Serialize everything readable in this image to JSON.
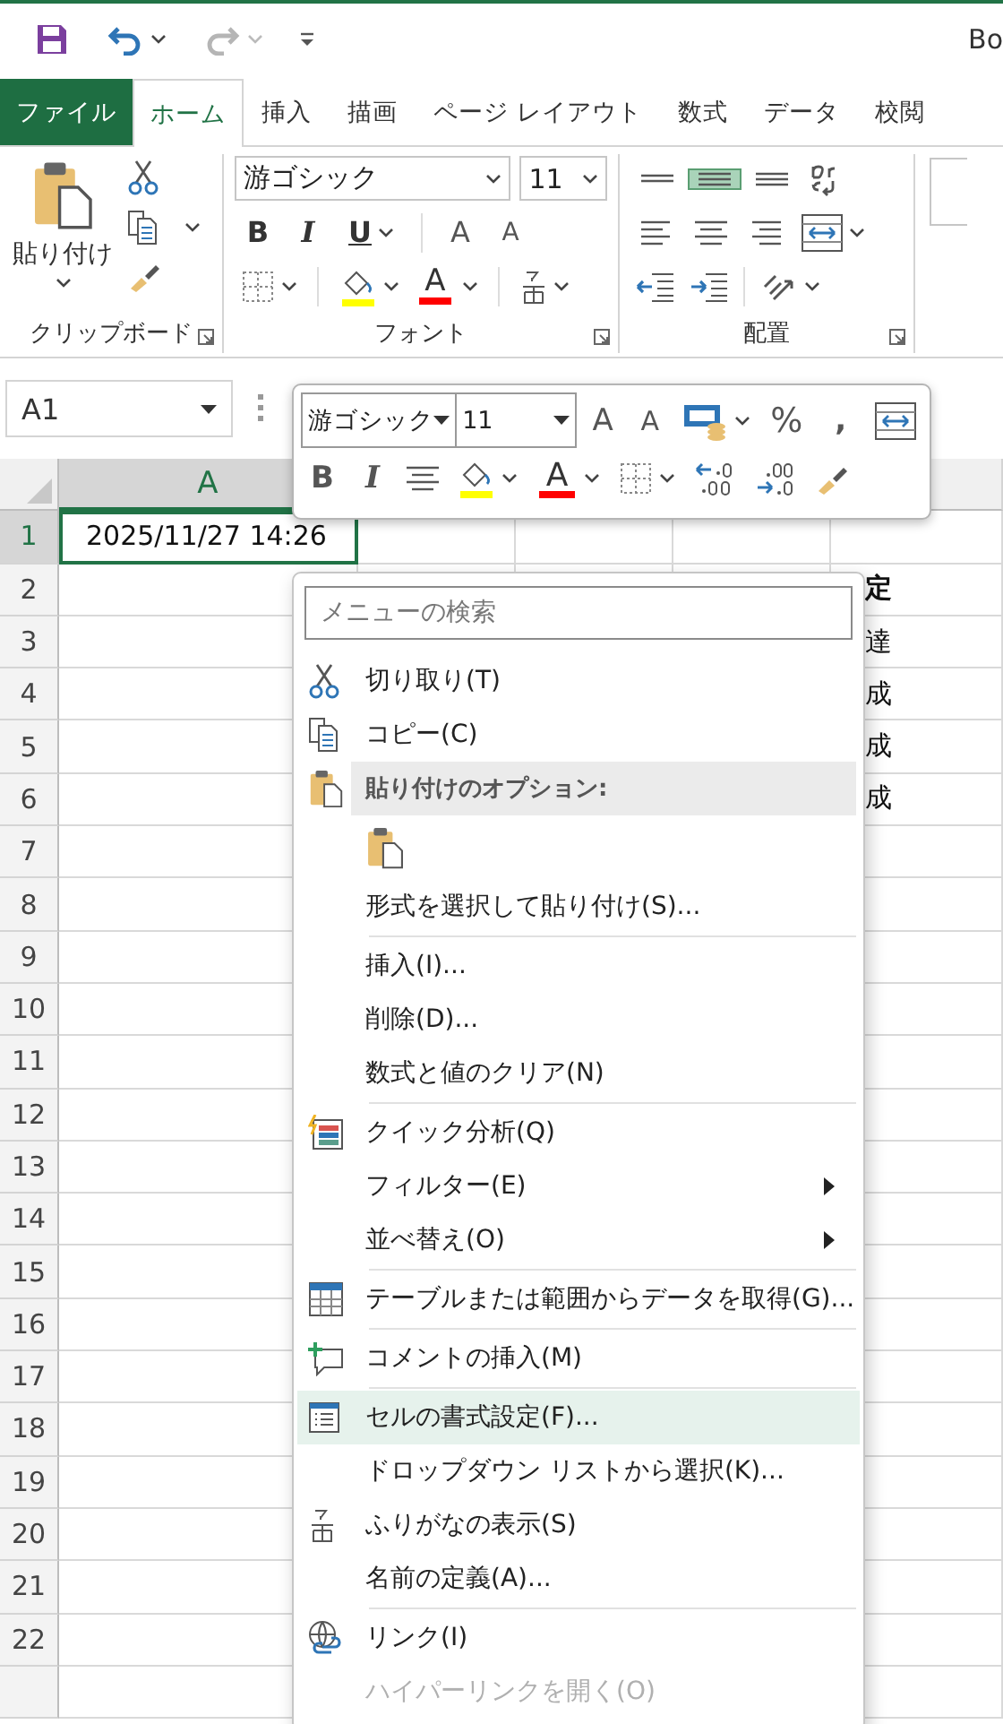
{
  "quick_access": {
    "buttons": [
      {
        "kind": "save",
        "disabled": false
      },
      {
        "kind": "undo",
        "disabled": false
      },
      {
        "kind": "redo",
        "disabled": true
      },
      {
        "kind": "customize",
        "disabled": false
      }
    ],
    "title": "Bo"
  },
  "ribbon_tabs": [
    {
      "label": "ファイル",
      "kind": "file",
      "selected": false
    },
    {
      "label": "ホーム",
      "kind": "tab",
      "selected": true
    },
    {
      "label": "挿入",
      "kind": "tab",
      "selected": false
    },
    {
      "label": "描画",
      "kind": "tab",
      "selected": false
    },
    {
      "label": "ページ レイアウト",
      "kind": "tab",
      "selected": false
    },
    {
      "label": "数式",
      "kind": "tab",
      "selected": false
    },
    {
      "label": "データ",
      "kind": "tab",
      "selected": false
    },
    {
      "label": "校閲",
      "kind": "tab",
      "selected": false
    }
  ],
  "ribbon": {
    "clipboard": {
      "paste_label": "貼り付け",
      "group_label": "クリップボード"
    },
    "font": {
      "font_name": "游ゴシック",
      "font_size": "11",
      "bold": "B",
      "italic": "I",
      "underline": "U",
      "grow": "A",
      "shrink": "A",
      "font_color_label": "A",
      "group_label": "フォント"
    },
    "alignment": {
      "vertical": [
        {
          "kind": "top",
          "selected": false
        },
        {
          "kind": "middle",
          "selected": true
        },
        {
          "kind": "bottom",
          "selected": false
        }
      ],
      "horizontal": [
        {
          "kind": "left",
          "selected": false
        },
        {
          "kind": "center",
          "selected": false
        },
        {
          "kind": "right",
          "selected": false
        }
      ],
      "group_label": "配置"
    }
  },
  "formula_bar": {
    "name_box": "A1"
  },
  "mini_toolbar": {
    "font_name": "游ゴシック",
    "font_size": "11",
    "grow": "A",
    "shrink": "A",
    "percent": "%",
    "comma": ",",
    "bold": "B",
    "italic": "I",
    "font_color_label": "A"
  },
  "sheet": {
    "columns": [
      {
        "label": "A",
        "selected": true
      }
    ],
    "rows": [
      {
        "header": "1",
        "selected": true,
        "column_a": "2025/11/27 14:26"
      },
      {
        "header": "2",
        "selected": false,
        "column_e": {
          "text": "定",
          "bold": true
        }
      },
      {
        "header": "3",
        "selected": false,
        "column_e": {
          "text": "達",
          "bold": false
        }
      },
      {
        "header": "4",
        "selected": false,
        "column_e": {
          "text": "成",
          "bold": false
        }
      },
      {
        "header": "5",
        "selected": false,
        "column_e": {
          "text": "成",
          "bold": false
        }
      },
      {
        "header": "6",
        "selected": false,
        "column_e": {
          "text": "成",
          "bold": false
        }
      },
      {
        "header": "7",
        "selected": false
      },
      {
        "header": "8",
        "selected": false
      },
      {
        "header": "9",
        "selected": false
      },
      {
        "header": "10",
        "selected": false
      },
      {
        "header": "11",
        "selected": false
      },
      {
        "header": "12",
        "selected": false
      },
      {
        "header": "13",
        "selected": false
      },
      {
        "header": "14",
        "selected": false
      },
      {
        "header": "15",
        "selected": false
      },
      {
        "header": "16",
        "selected": false
      },
      {
        "header": "17",
        "selected": false
      },
      {
        "header": "18",
        "selected": false
      },
      {
        "header": "19",
        "selected": false
      },
      {
        "header": "20",
        "selected": false
      },
      {
        "header": "21",
        "selected": false
      },
      {
        "header": "22",
        "selected": false
      }
    ]
  },
  "context_menu": {
    "search_placeholder": "メニューの検索",
    "items": [
      {
        "kind": "cut",
        "label": "切り取り(T)",
        "selected": false,
        "disabled": false
      },
      {
        "kind": "copy",
        "label": "コピー(C)",
        "selected": false,
        "disabled": false
      },
      {
        "kind": "paste-header",
        "label": "貼り付けのオプション:"
      },
      {
        "kind": "paste-option"
      },
      {
        "kind": "command",
        "label": "形式を選択して貼り付け(S)...",
        "selected": false,
        "disabled": false
      },
      {
        "kind": "separator"
      },
      {
        "kind": "command",
        "label": "挿入(I)...",
        "selected": false,
        "disabled": false
      },
      {
        "kind": "command",
        "label": "削除(D)...",
        "selected": false,
        "disabled": false
      },
      {
        "kind": "command",
        "label": "数式と値のクリア(N)",
        "selected": false,
        "disabled": false
      },
      {
        "kind": "separator"
      },
      {
        "kind": "quick-analysis",
        "label": "クイック分析(Q)",
        "selected": false,
        "disabled": false
      },
      {
        "kind": "submenu",
        "label": "フィルター(E)",
        "selected": false,
        "disabled": false
      },
      {
        "kind": "submenu",
        "label": "並べ替え(O)",
        "selected": false,
        "disabled": false
      },
      {
        "kind": "separator"
      },
      {
        "kind": "get-data",
        "label": "テーブルまたは範囲からデータを取得(G)...",
        "selected": false,
        "disabled": false
      },
      {
        "kind": "separator"
      },
      {
        "kind": "comment",
        "label": "コメントの挿入(M)",
        "selected": false,
        "disabled": false
      },
      {
        "kind": "separator"
      },
      {
        "kind": "format-cells",
        "label": "セルの書式設定(F)...",
        "selected": true,
        "disabled": false
      },
      {
        "kind": "command",
        "label": "ドロップダウン リストから選択(K)...",
        "selected": false,
        "disabled": false
      },
      {
        "kind": "phonetic",
        "label": "ふりがなの表示(S)",
        "selected": false,
        "disabled": false
      },
      {
        "kind": "command",
        "label": "名前の定義(A)...",
        "selected": false,
        "disabled": false
      },
      {
        "kind": "separator"
      },
      {
        "kind": "link",
        "label": "リンク(I)",
        "selected": false,
        "disabled": false
      },
      {
        "kind": "command",
        "label": "ハイパーリンクを開く(O)",
        "selected": false,
        "disabled": true
      }
    ]
  }
}
